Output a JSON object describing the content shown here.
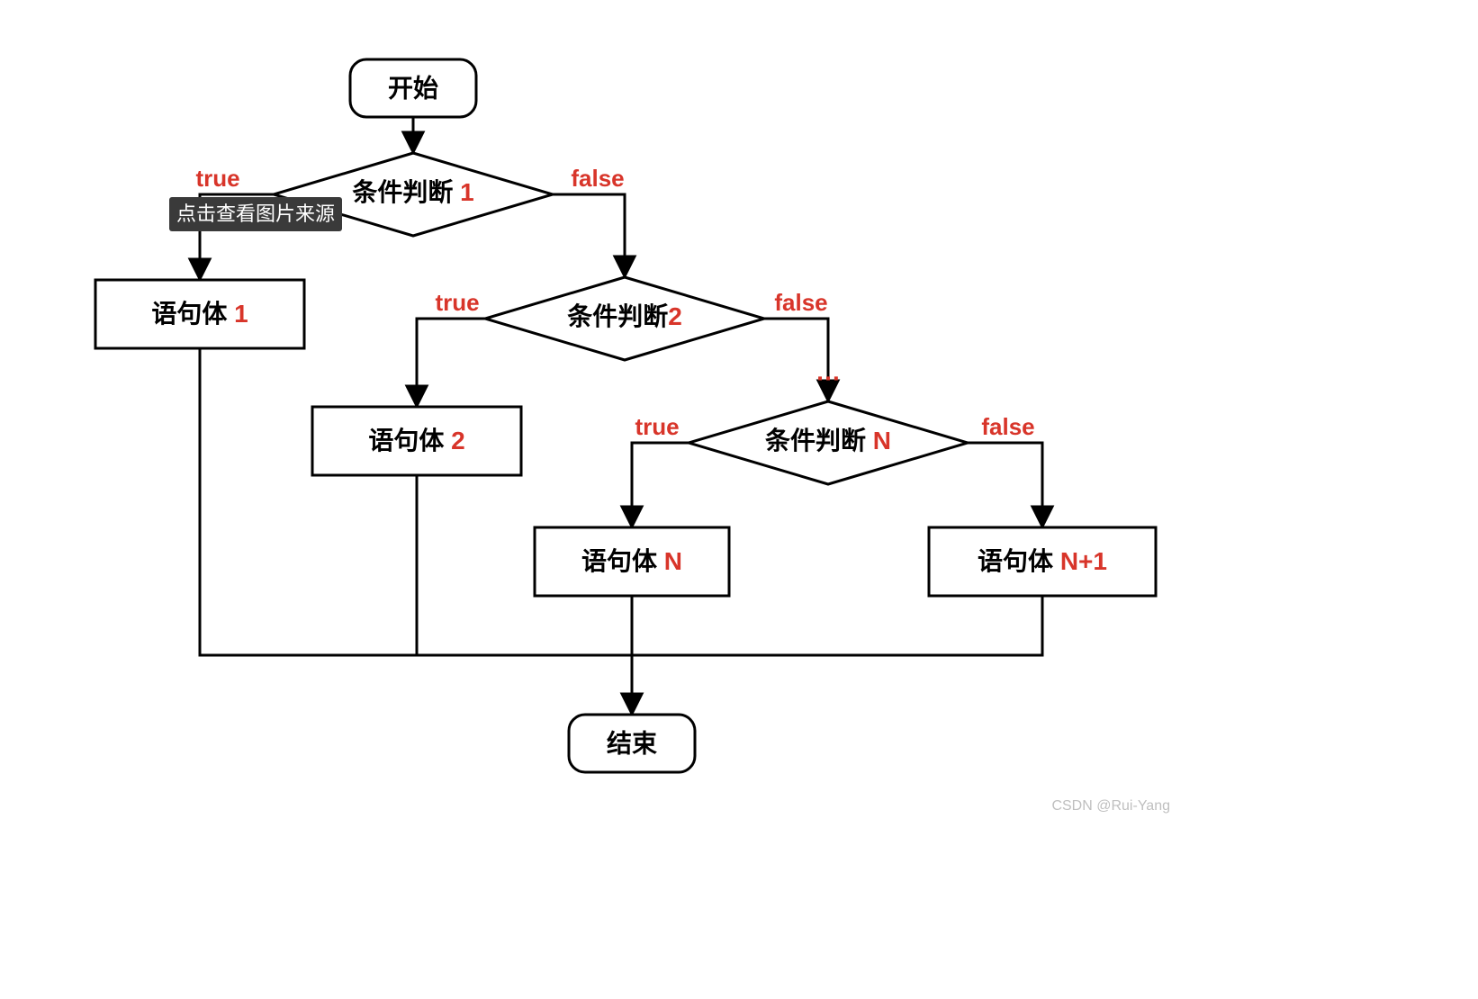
{
  "nodes": {
    "start": "开始",
    "end": "结束",
    "cond1_text": "条件判断",
    "cond1_num": "1",
    "cond2_text": "条件判断",
    "cond2_num": "2",
    "condN_text": "条件判断",
    "condN_num": "N",
    "body1_text": "语句体",
    "body1_num": "1",
    "body2_text": "语句体",
    "body2_num": "2",
    "bodyN_text": "语句体",
    "bodyN_num": "N",
    "bodyN1_text": "语句体",
    "bodyN1_num": "N+1",
    "ellipsis": "…"
  },
  "labels": {
    "true": "true",
    "false": "false"
  },
  "tooltip": "点击查看图片来源",
  "watermark": "CSDN @Rui-Yang"
}
